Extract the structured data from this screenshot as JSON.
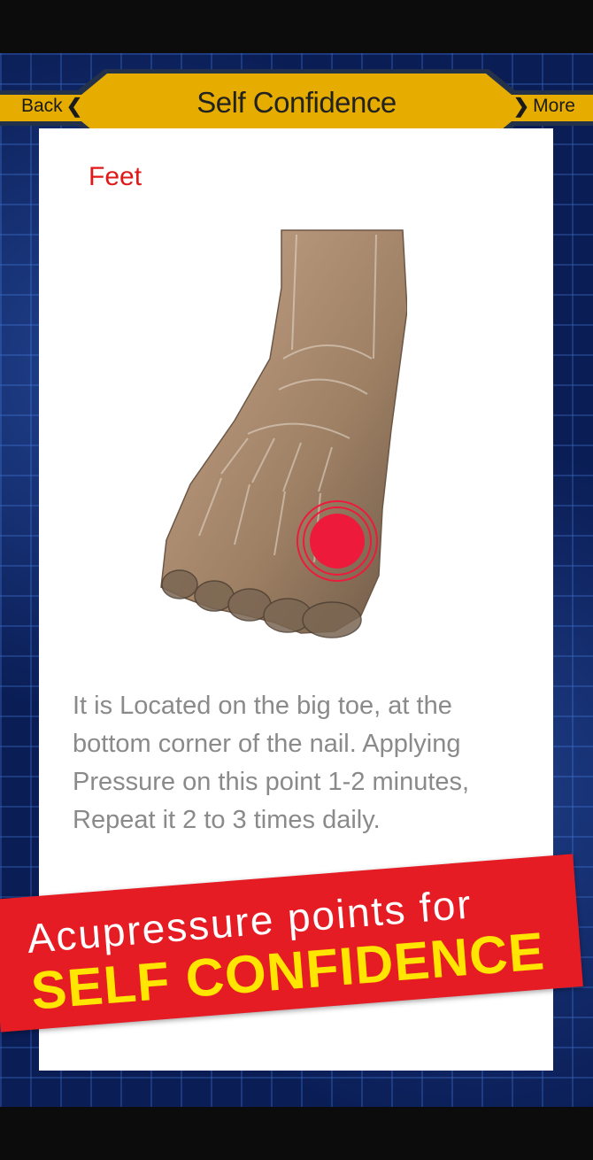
{
  "header": {
    "title": "Self Confidence",
    "back_label": "Back",
    "more_label": "More"
  },
  "content": {
    "section_label": "Feet",
    "description": "It is Located on the big toe, at the bottom corner of the nail. Applying Pressure on this point 1-2 minutes, Repeat it 2 to 3 times daily."
  },
  "banner": {
    "line1": "Acupressure points for",
    "line2": "SELF CONFIDENCE"
  },
  "colors": {
    "header_gold": "#e6ad00",
    "header_outline": "#23324a",
    "section_red": "#e01818",
    "banner_red": "#e61c24",
    "banner_yellow": "#ffe500",
    "point_red": "#ed1a3b"
  },
  "icons": {
    "back": "chevron-left-icon",
    "more": "chevron-right-icon",
    "point": "pressure-point-icon"
  }
}
